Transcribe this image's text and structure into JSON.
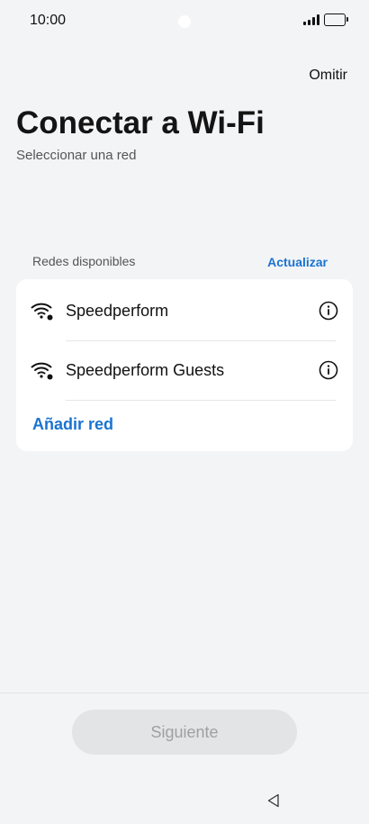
{
  "status_bar": {
    "time": "10:00",
    "icons": [
      "signal-icon",
      "battery-icon"
    ]
  },
  "header": {
    "skip_label": "Omitir",
    "title": "Conectar a Wi-Fi",
    "subtitle": "Seleccionar una red"
  },
  "networks_section": {
    "label": "Redes disponibles",
    "refresh_label": "Actualizar",
    "networks": [
      {
        "name": "Speedperform",
        "icon": "wifi-locked-icon",
        "info_icon": "info-icon"
      },
      {
        "name": "Speedperform Guests",
        "icon": "wifi-locked-icon",
        "info_icon": "info-icon"
      }
    ],
    "add_network_label": "Añadir red"
  },
  "footer": {
    "next_label": "Siguiente",
    "back_icon": "back-triangle-icon"
  },
  "colors": {
    "background": "#f3f4f6",
    "card": "#ffffff",
    "accent": "#1a73d1",
    "disabled_button": "#e3e4e6",
    "disabled_text": "#a0a0a0"
  }
}
